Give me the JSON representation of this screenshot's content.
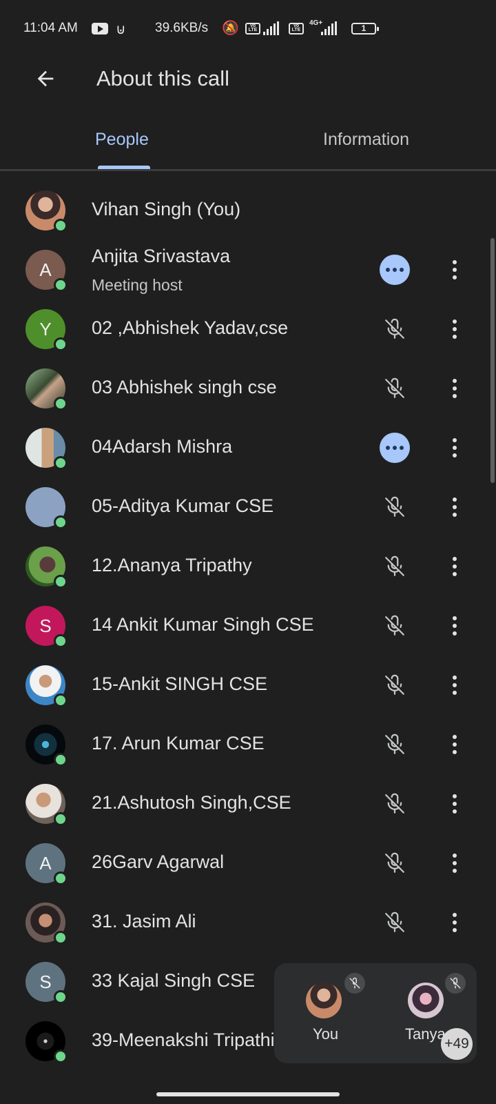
{
  "status_bar": {
    "time": "11:04 AM",
    "speed": "39.6KB/s",
    "volte": "Vo LTE",
    "network": "4G+",
    "battery": "1"
  },
  "header": {
    "title": "About this call"
  },
  "tabs": [
    {
      "label": "People",
      "active": true
    },
    {
      "label": "Information",
      "active": false
    }
  ],
  "participants": [
    {
      "name": "Vihan Singh (You)",
      "avatar_letter": "",
      "avatar_color": "#c98a6a",
      "action": "none"
    },
    {
      "name": "Anjita Srivastava",
      "subtitle": "Meeting host",
      "avatar_letter": "A",
      "avatar_color": "#7b5a4f",
      "action": "more"
    },
    {
      "name": "02 ,Abhishek Yadav,cse",
      "avatar_letter": "Y",
      "avatar_color": "#4f8f2b",
      "action": "muted"
    },
    {
      "name": "03 Abhishek singh cse",
      "avatar_letter": "",
      "avatar_color": "#5a6b4a",
      "action": "muted"
    },
    {
      "name": "04Adarsh Mishra",
      "avatar_letter": "",
      "avatar_color": "#a9b4ad",
      "action": "more"
    },
    {
      "name": "05-Aditya Kumar CSE",
      "avatar_letter": "",
      "avatar_color": "#8ba2c2",
      "action": "muted"
    },
    {
      "name": "12.Ananya Tripathy",
      "avatar_letter": "",
      "avatar_color": "#3f6a2c",
      "action": "muted"
    },
    {
      "name": "14 Ankit Kumar Singh CSE",
      "avatar_letter": "S",
      "avatar_color": "#c2185b",
      "action": "muted"
    },
    {
      "name": "15-Ankit SINGH CSE",
      "avatar_letter": "",
      "avatar_color": "#4a90c8",
      "action": "muted"
    },
    {
      "name": "17. Arun Kumar CSE",
      "avatar_letter": "",
      "avatar_color": "#0f1a24",
      "action": "muted"
    },
    {
      "name": "21.Ashutosh Singh,CSE",
      "avatar_letter": "",
      "avatar_color": "#8a7f76",
      "action": "muted"
    },
    {
      "name": "26Garv Agarwal",
      "avatar_letter": "A",
      "avatar_color": "#5f7280",
      "action": "muted"
    },
    {
      "name": "31. Jasim Ali",
      "avatar_letter": "",
      "avatar_color": "#6b5a55",
      "action": "muted"
    },
    {
      "name": "33 Kajal Singh CSE",
      "avatar_letter": "S",
      "avatar_color": "#5f7280",
      "action": "muted"
    },
    {
      "name": "39-Meenakshi Tripathi",
      "avatar_letter": "",
      "avatar_color": "#0a0a0a",
      "action": "muted"
    }
  ],
  "floating_panel": {
    "tiles": [
      {
        "label": "You"
      },
      {
        "label": "Tanya"
      }
    ],
    "more_count": "+49"
  },
  "colors": {
    "background": "#1f1f1f",
    "accent": "#a8c7fa",
    "online": "#6dd58c"
  }
}
